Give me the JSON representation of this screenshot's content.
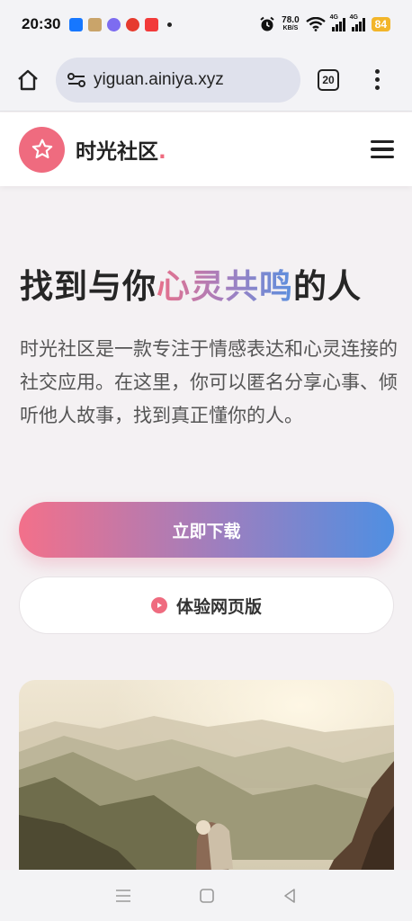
{
  "status_bar": {
    "time": "20:30",
    "speed_value": "78.0",
    "speed_unit": "KB/S",
    "network_1": "4G",
    "network_2": "4G",
    "battery": "84",
    "battery_color": "#f2b52a"
  },
  "browser": {
    "url": "yiguan.ainiya.xyz",
    "tab_count": "20",
    "icons": [
      "home-icon",
      "site-settings-icon",
      "tabs-icon",
      "overflow-menu-icon"
    ]
  },
  "site_header": {
    "brand": "时光社区",
    "brand_dot": ".",
    "logo_icon": "star-icon",
    "menu_icon": "hamburger-icon",
    "accent_color": "#ef6b7f"
  },
  "hero": {
    "title_prefix": "找到与你",
    "title_highlight": "心灵共鸣",
    "title_suffix": "的人",
    "description": "时光社区是一款专注于情感表达和心灵连接的社交应用。在这里，你可以匿名分享心事、倾听他人故事，找到真正懂你的人。",
    "download_label": "立即下载",
    "web_label": "体验网页版",
    "gradient_start": "#f3708a",
    "gradient_end": "#4f8fe2"
  },
  "system_nav": {
    "icons": [
      "menu-icon",
      "home-square-icon",
      "back-icon"
    ]
  }
}
